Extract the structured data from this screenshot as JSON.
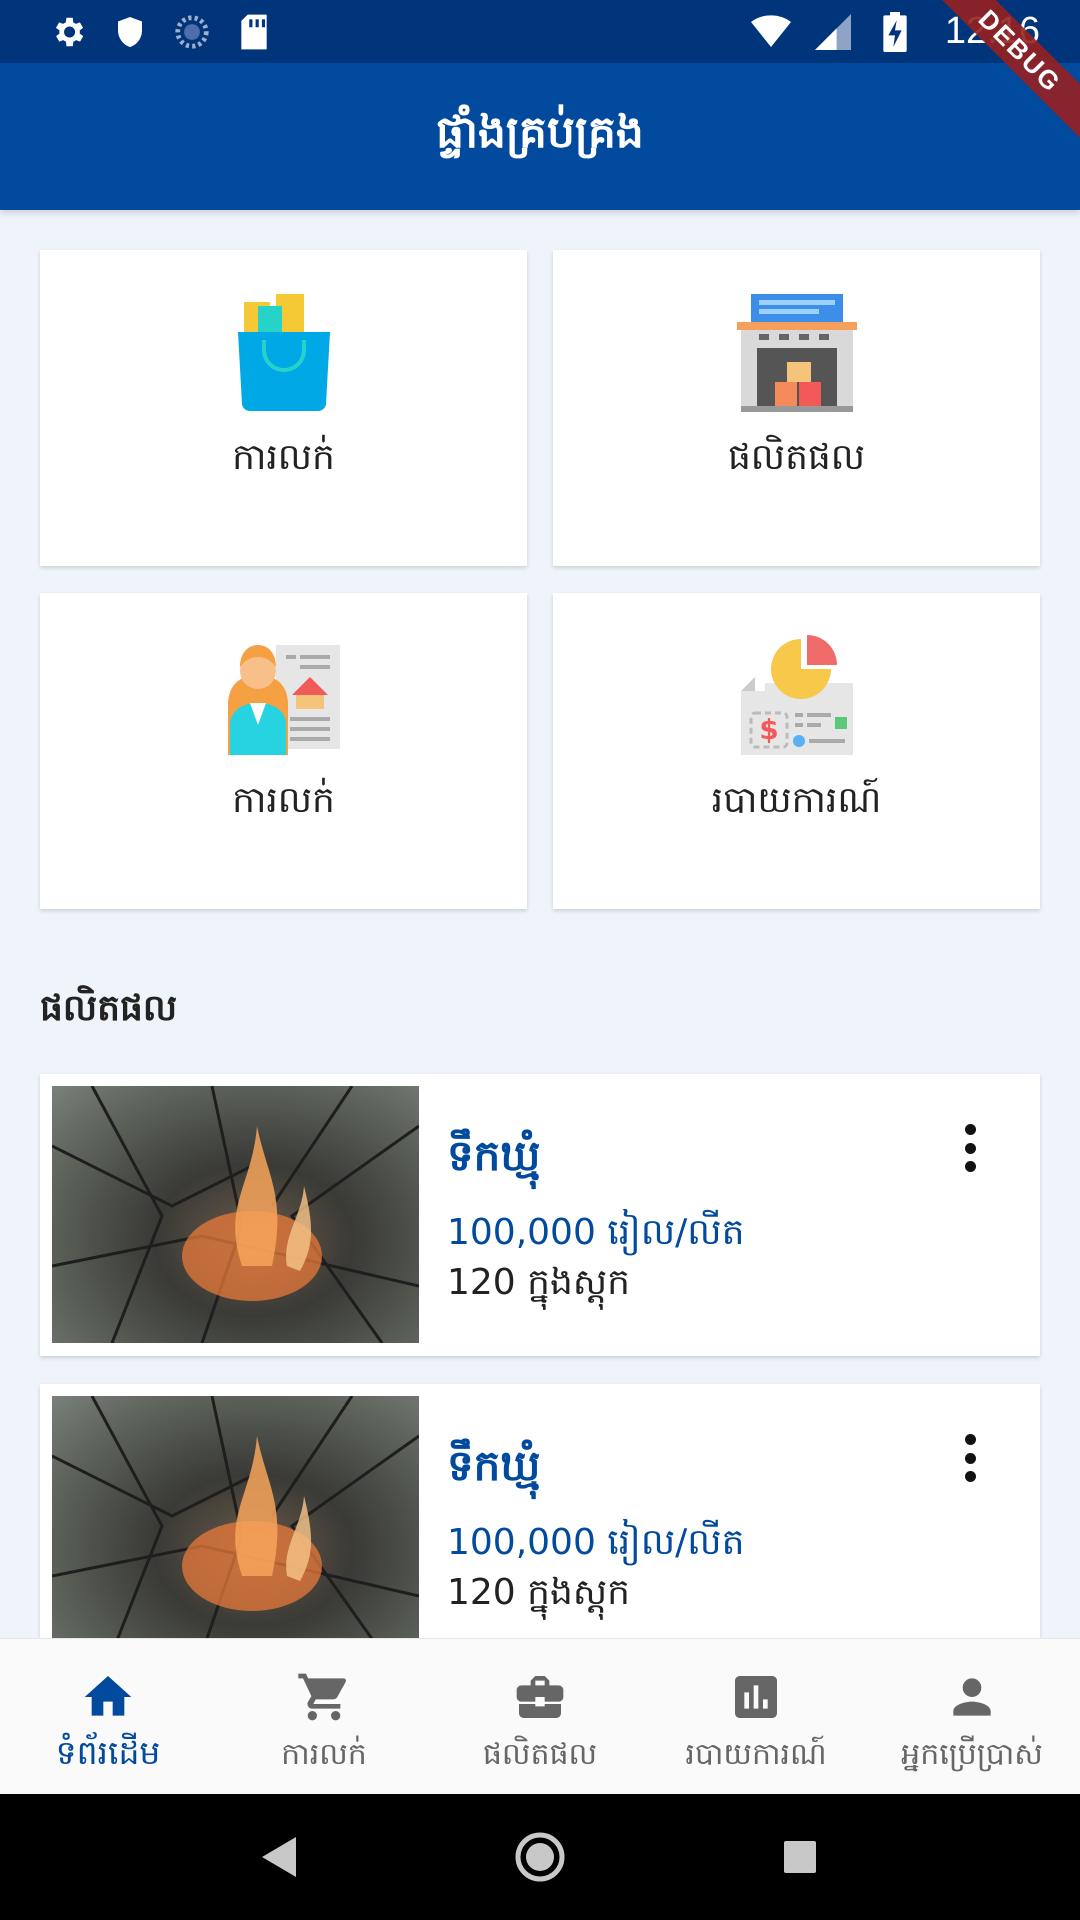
{
  "status_bar": {
    "time": "12:16",
    "debug_label": "DEBUG"
  },
  "app_bar": {
    "title": "ផ្ទាំងគ្រប់គ្រង"
  },
  "grid": [
    {
      "label": "ការលក់",
      "icon": "shopping-bag-icon"
    },
    {
      "label": "ផលិតផល",
      "icon": "store-icon"
    },
    {
      "label": "ការលក់",
      "icon": "seller-icon"
    },
    {
      "label": "របាយការណ៍",
      "icon": "report-icon"
    }
  ],
  "products_section": {
    "title": "ផលិតផល"
  },
  "products": [
    {
      "name": "ទឹកឃ្មុំ",
      "price": "100,000 រៀល/លីត",
      "stock": "120 ក្នុងស្តុក"
    },
    {
      "name": "ទឹកឃ្មុំ",
      "price": "100,000 រៀល/លីត",
      "stock": "120 ក្នុងស្តុក"
    }
  ],
  "bottom_nav": [
    {
      "label": "ទំព័រដើម",
      "icon": "home-icon",
      "active": true
    },
    {
      "label": "ការលក់",
      "icon": "cart-icon"
    },
    {
      "label": "ផលិតផល",
      "icon": "briefcase-icon"
    },
    {
      "label": "របាយការណ៍",
      "icon": "chart-icon"
    },
    {
      "label": "អ្នកប្រើប្រាស់",
      "icon": "person-icon"
    }
  ],
  "colors": {
    "primary": "#024a9e",
    "status_bar": "#01357b",
    "background": "#eff4fb"
  }
}
